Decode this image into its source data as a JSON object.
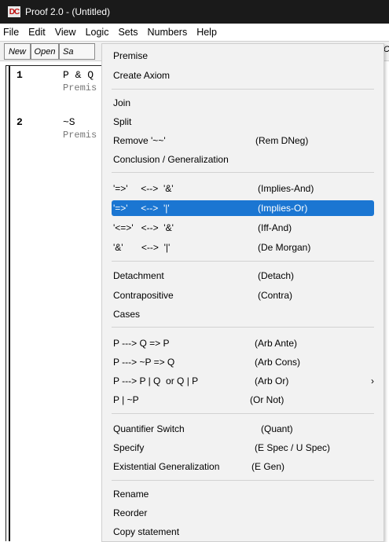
{
  "window": {
    "icon_text": "DC",
    "title": "Proof 2.0 - (Untitled)"
  },
  "menubar": [
    "File",
    "Edit",
    "View",
    "Logic",
    "Sets",
    "Numbers",
    "Help"
  ],
  "toolbar": {
    "buttons": [
      "New",
      "Open",
      "Sa"
    ],
    "right_clip": "C"
  },
  "proof": {
    "lines": [
      {
        "num": "1",
        "statement": "P & Q",
        "reason": "Premis"
      },
      {
        "num": "2",
        "statement": "~S",
        "reason": "Premis"
      }
    ]
  },
  "logic_menu": {
    "items": [
      {
        "label": "Premise",
        "abbr": ""
      },
      {
        "label": "Create Axiom",
        "abbr": ""
      },
      {
        "label": "Join",
        "abbr": ""
      },
      {
        "label": "Split",
        "abbr": ""
      },
      {
        "label": "Remove '~~'",
        "abbr": "(Rem DNeg)"
      },
      {
        "label": "Conclusion / Generalization",
        "abbr": ""
      },
      {
        "label": "'=>'     <-->  '&'",
        "abbr": "(Implies-And)"
      },
      {
        "label": "'=>'     <-->  '|'",
        "abbr": "(Implies-Or)"
      },
      {
        "label": "'<=>'   <-->  '&'",
        "abbr": "(Iff-And)"
      },
      {
        "label": "'&'       <-->  '|'",
        "abbr": "(De Morgan)"
      },
      {
        "label": "Detachment",
        "abbr": "(Detach)"
      },
      {
        "label": "Contrapositive",
        "abbr": "(Contra)"
      },
      {
        "label": "Cases",
        "abbr": ""
      },
      {
        "label": "P ---> Q => P",
        "abbr": "(Arb Ante)"
      },
      {
        "label": "P ---> ~P => Q",
        "abbr": "(Arb Cons)"
      },
      {
        "label": "P ---> P | Q  or Q | P",
        "abbr": "(Arb Or)"
      },
      {
        "label": "P | ~P",
        "abbr": "(Or Not)"
      },
      {
        "label": "Quantifier Switch",
        "abbr": "(Quant)"
      },
      {
        "label": "Specify",
        "abbr": "(E Spec / U Spec)"
      },
      {
        "label": "Existential Generalization",
        "abbr": "(E Gen)"
      },
      {
        "label": "Rename",
        "abbr": ""
      },
      {
        "label": "Reorder",
        "abbr": ""
      },
      {
        "label": "Copy statement",
        "abbr": ""
      }
    ],
    "submenu_arrow": "›"
  }
}
